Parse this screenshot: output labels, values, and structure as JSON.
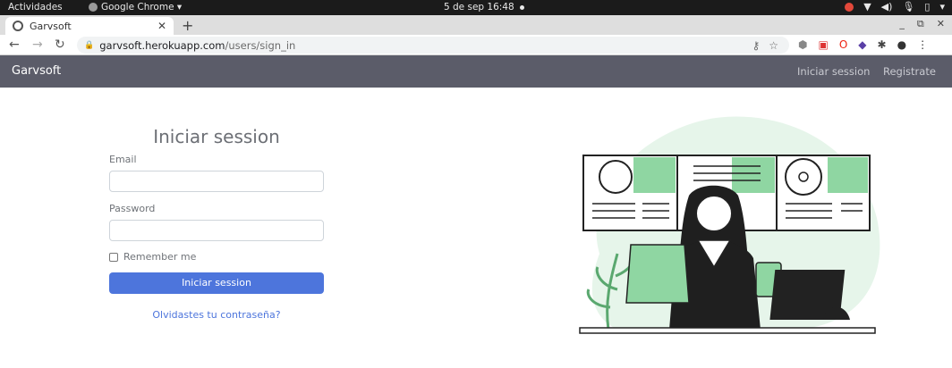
{
  "system_bar": {
    "activities": "Actividades",
    "app_name": "Google Chrome ▾",
    "clock": "5 de sep  16:48"
  },
  "browser": {
    "tab_title": "Garvsoft",
    "url_host": "garvsoft.herokuapp.com",
    "url_path": "/users/sign_in"
  },
  "navbar": {
    "brand": "Garvsoft",
    "links": [
      "Iniciar session",
      "Registrate"
    ]
  },
  "login": {
    "title": "Iniciar session",
    "email_label": "Email",
    "email_value": "",
    "password_label": "Password",
    "password_value": "",
    "remember_label": "Remember me",
    "submit_label": "Iniciar session",
    "forgot_link": "Olvidastes tu contraseña?"
  },
  "colors": {
    "navbar_bg": "#5b5c69",
    "primary": "#4d75dc",
    "illustration_green": "#8fd6a2"
  }
}
